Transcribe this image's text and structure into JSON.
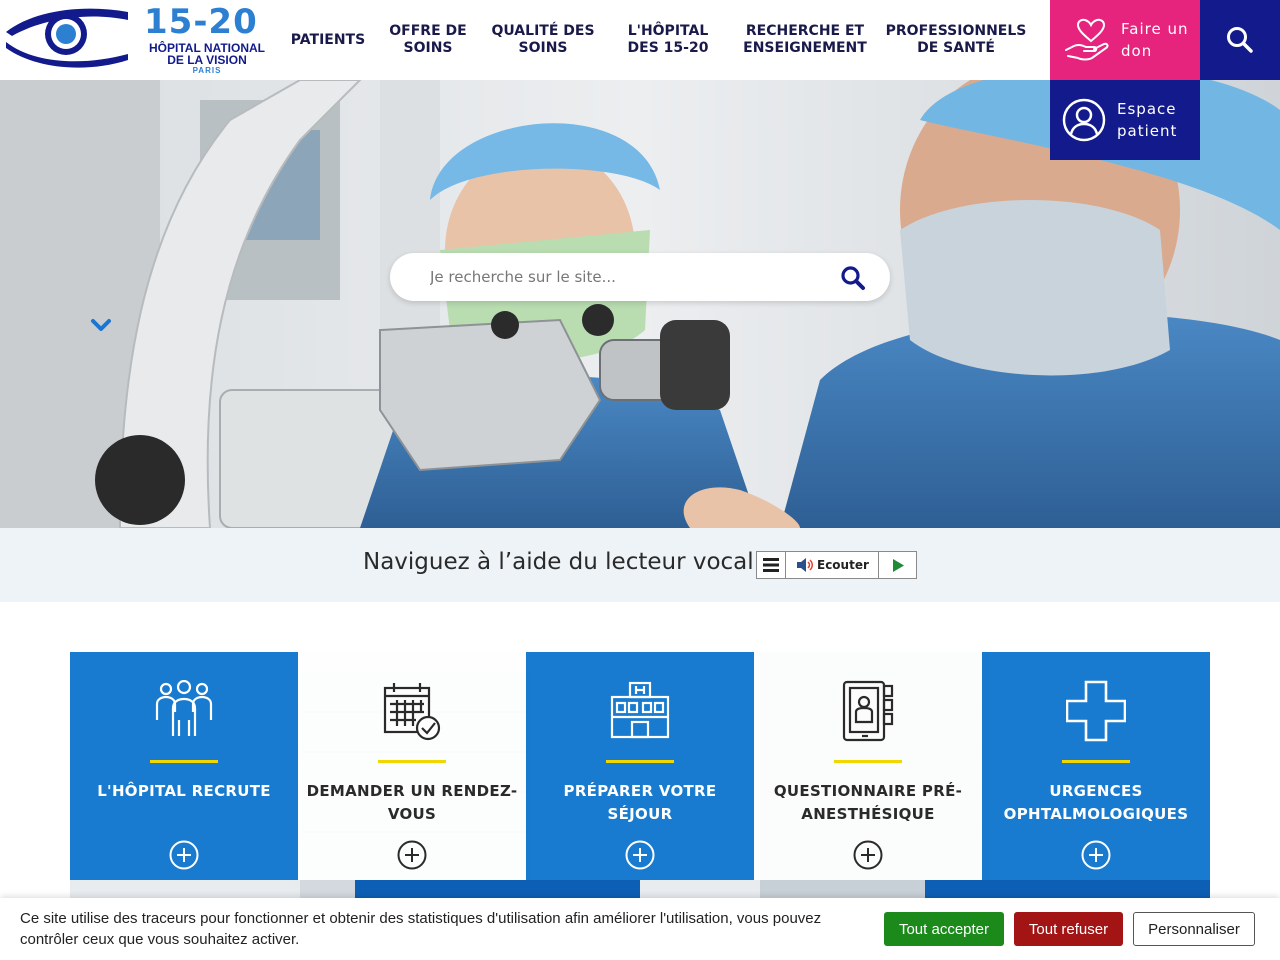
{
  "logo": {
    "number": "15-20",
    "line1": "HÔPITAL NATIONAL",
    "line2": "DE LA VISION",
    "line3": "PARIS",
    "icon": "eye-logo-icon"
  },
  "nav": {
    "items": [
      {
        "lines": [
          "PATIENTS"
        ]
      },
      {
        "lines": [
          "OFFRE DE",
          "SOINS"
        ]
      },
      {
        "lines": [
          "QUALITÉ DES",
          "SOINS"
        ]
      },
      {
        "lines": [
          "L'HÔPITAL",
          "DES 15-20"
        ]
      },
      {
        "lines": [
          "RECHERCHE ET",
          "ENSEIGNEMENT"
        ]
      },
      {
        "lines": [
          "PROFESSIONNELS",
          "DE SANTÉ"
        ]
      }
    ]
  },
  "side_buttons": {
    "donate": {
      "line1": "Faire un",
      "line2": "don",
      "icon": "heart-hand-icon"
    },
    "patient": {
      "line1": "Espace",
      "line2": "patient",
      "icon": "user-circle-icon"
    },
    "search_icon": "search-icon"
  },
  "hero": {
    "search_placeholder": "Je recherche sur le site...",
    "scroll_icon": "chevron-down-icon"
  },
  "vocal": {
    "label": "Naviguez à l’aide du lecteur vocal :",
    "listen": "Ecouter",
    "menu_icon": "menu-icon",
    "speaker_icon": "speaker-icon",
    "play_icon": "play-icon"
  },
  "cards": [
    {
      "label": "L'HÔPITAL RECRUTE",
      "icon": "people-icon",
      "style": "blue"
    },
    {
      "label": "DEMANDER UN RENDEZ-VOUS",
      "icon": "calendar-check-icon",
      "style": "white"
    },
    {
      "label": "PRÉPARER VOTRE SÉJOUR",
      "icon": "hospital-icon",
      "style": "blue"
    },
    {
      "label": "QUESTIONNAIRE PRÉ-ANESTHÉSIQUE",
      "icon": "clipboard-icon",
      "style": "white"
    },
    {
      "label": "URGENCES OPHTALMOLOGIQUES",
      "icon": "medical-cross-icon",
      "style": "blue"
    }
  ],
  "cookie": {
    "text": "Ce site utilise des traceurs pour fonctionner et obtenir des statistiques d'utilisation afin améliorer l'utilisation, vous pouvez contrôler ceux que vous souhaitez activer.",
    "accept": "Tout accepter",
    "refuse": "Tout refuser",
    "customize": "Personnaliser"
  },
  "colors": {
    "brand_blue": "#2d7fd2",
    "navy": "#121a8c",
    "pink": "#e6247d",
    "card_blue": "#1076cd",
    "accent_yellow": "#f2d600",
    "accept_green": "#1b8a1b",
    "refuse_red": "#a31414"
  }
}
